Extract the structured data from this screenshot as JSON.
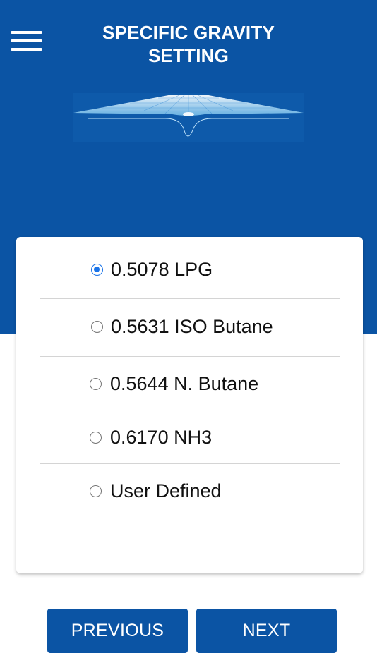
{
  "header": {
    "title_line1": "SPECIFIC GRAVITY",
    "title_line2": "SETTING"
  },
  "options": [
    {
      "label": "0.5078 LPG",
      "selected": true
    },
    {
      "label": "0.5631 ISO Butane",
      "selected": false
    },
    {
      "label": "0.5644 N. Butane",
      "selected": false
    },
    {
      "label": "0.6170 NH3",
      "selected": false
    },
    {
      "label": "User Defined",
      "selected": false
    }
  ],
  "buttons": {
    "previous": "PREVIOUS",
    "next": "NEXT"
  },
  "colors": {
    "brand_blue": "#0b54a4",
    "radio_selected": "#1a73e8"
  },
  "icons": {
    "menu": "hamburger-menu-icon",
    "logo": "gravity-well-logo"
  }
}
